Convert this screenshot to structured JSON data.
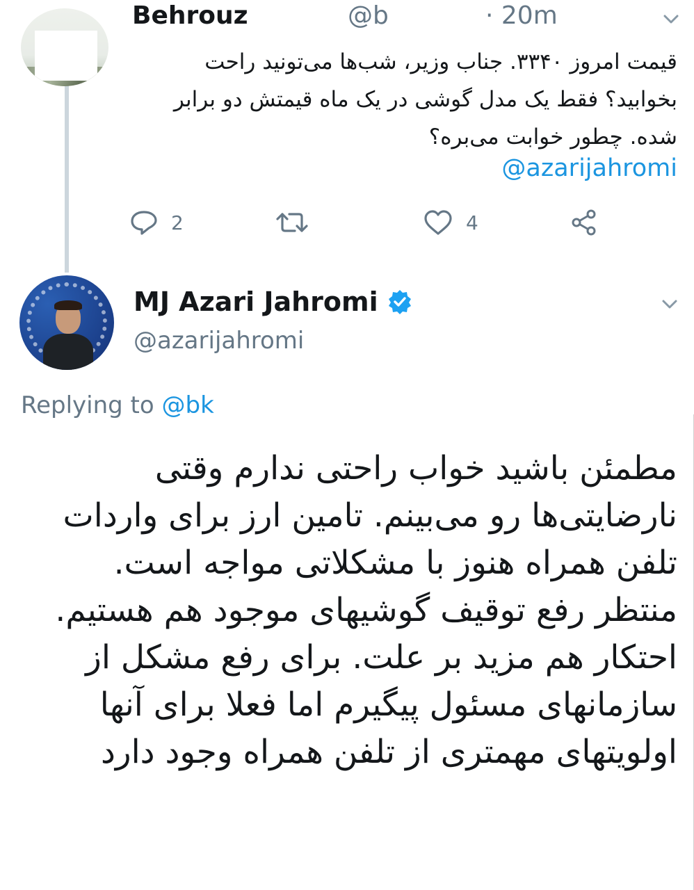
{
  "reply_tweet": {
    "author_name": "Behrouz",
    "author_handle": "@b",
    "timestamp": "· 20m",
    "text": "قیمت امروز ۳۳۴۰. جناب وزیر، شب‌ها می‌تونید راحت بخوابید؟ فقط یک مدل گوشی در یک ماه قیمتش دو برابر شده. چطور خوابت می‌بره؟",
    "mention": "@azarijahromi",
    "actions": {
      "reply_count": "2",
      "retweet_count": "",
      "like_count": "4"
    }
  },
  "main_tweet": {
    "author_name": "MJ Azari Jahromi",
    "verified": true,
    "author_handle": "@azarijahromi",
    "replying_prefix": "Replying to",
    "replying_to": "@bk",
    "text": "مطمئن باشید خواب راحتی ندارم وقتی نارضایتی‌ها رو می‌بینم. تامین ارز برای واردات تلفن همراه هنوز با مشکلاتی مواجه است. منتظر رفع توقیف گوشیهای موجود هم هستیم. احتکار هم مزید بر علت. برای رفع مشکل از سازمانهای مسئول پیگیرم اما فعلا برای آنها اولویتهای مهمتری از تلفن همراه وجود دارد"
  },
  "colors": {
    "link": "#1b95e0",
    "secondary_text": "#657786",
    "verified_badge": "#1da1f2",
    "thread_line": "#ccd6dd"
  },
  "icons": [
    "reply-icon",
    "retweet-icon",
    "like-icon",
    "share-icon",
    "chevron-down-icon",
    "verified-badge-icon"
  ]
}
